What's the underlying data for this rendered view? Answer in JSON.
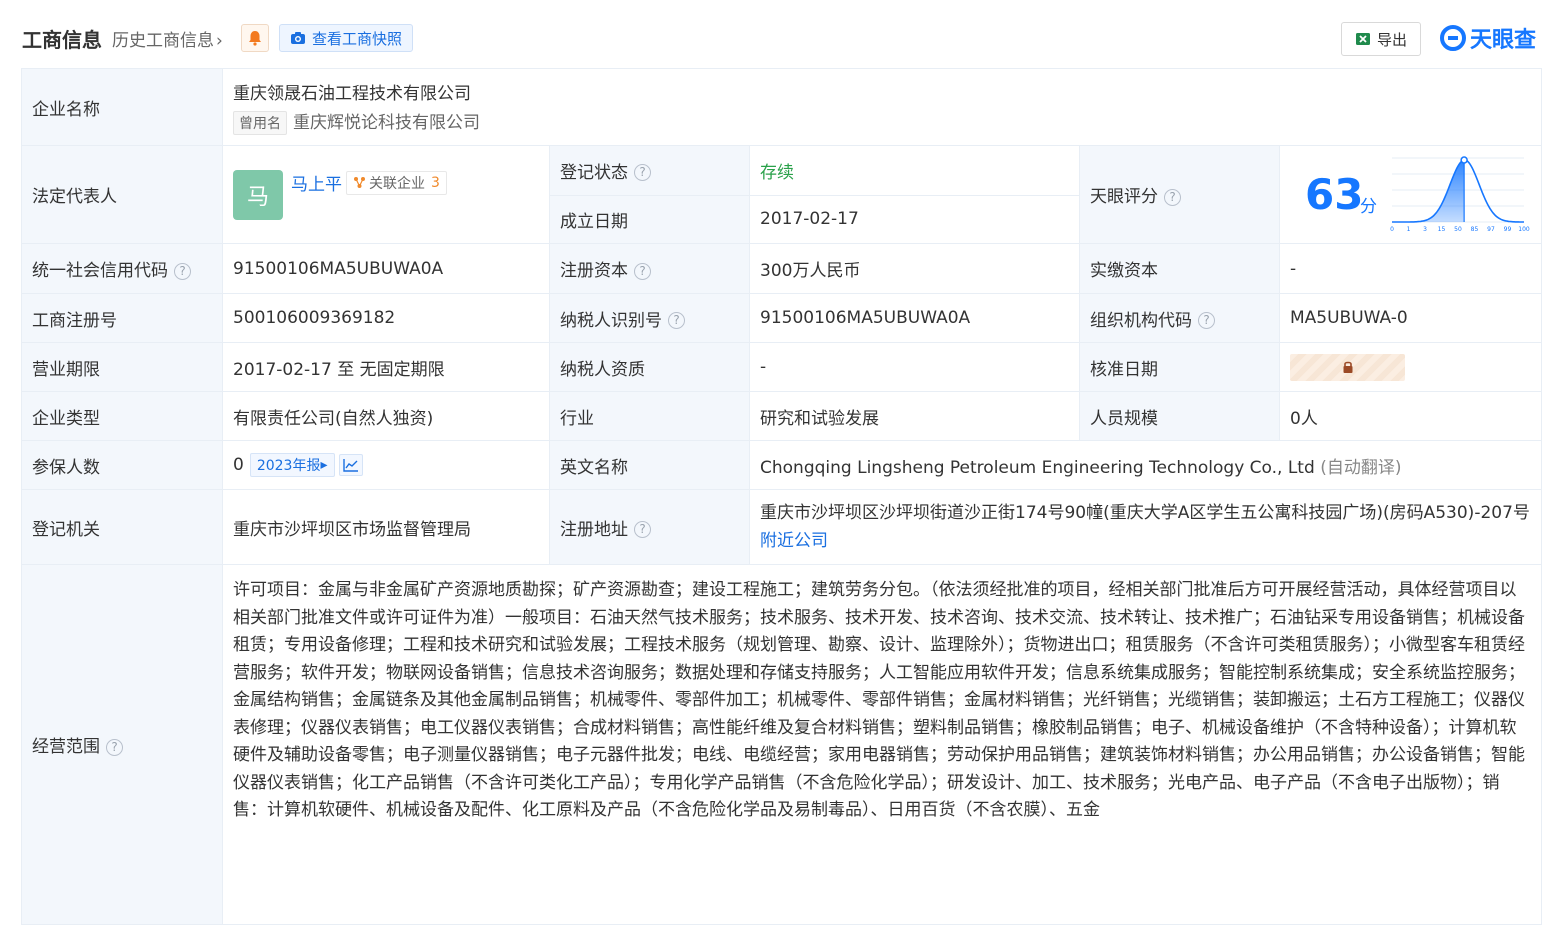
{
  "header": {
    "title": "工商信息",
    "history_link": "历史工商信息",
    "history_chevron": "›",
    "snapshot_button": "查看工商快照",
    "export_button": "导出",
    "logo_text": "天眼查",
    "colors": {
      "accent": "#1677ff",
      "green": "#2aa14a",
      "orange": "#f08a2c"
    }
  },
  "rows": {
    "company_name": {
      "label": "企业名称",
      "value": "重庆领晟石油工程技术有限公司",
      "alt_tag": "曾用名",
      "alt_value": "重庆辉悦论科技有限公司"
    },
    "legal_rep": {
      "label": "法定代表人",
      "avatar_char": "马",
      "name": "马上平",
      "related_label": "关联企业",
      "related_count": "3"
    },
    "reg_status": {
      "label": "登记状态",
      "value": "存续"
    },
    "founded": {
      "label": "成立日期",
      "value": "2017-02-17"
    },
    "tianyan_score": {
      "label": "天眼评分",
      "score": "63",
      "unit": "分",
      "score_level": 63,
      "axis_ticks": [
        "0",
        "1",
        "3",
        "15",
        "50",
        "85",
        "97",
        "99",
        "100"
      ]
    },
    "credit_code": {
      "label": "统一社会信用代码",
      "value": "91500106MA5UBUWA0A"
    },
    "reg_capital": {
      "label": "注册资本",
      "value": "300万人民币"
    },
    "paid_capital": {
      "label": "实缴资本",
      "value": "-"
    },
    "reg_number": {
      "label": "工商注册号",
      "value": "500106009369182"
    },
    "taxpayer_id": {
      "label": "纳税人识别号",
      "value": "91500106MA5UBUWA0A"
    },
    "org_code": {
      "label": "组织机构代码",
      "value": "MA5UBUWA-0"
    },
    "term": {
      "label": "营业期限",
      "value": "2017-02-17 至 无固定期限"
    },
    "tax_qualification": {
      "label": "纳税人资质",
      "value": "-"
    },
    "approval_date": {
      "label": "核准日期"
    },
    "company_type": {
      "label": "企业类型",
      "value": "有限责任公司(自然人独资)"
    },
    "industry": {
      "label": "行业",
      "value": "研究和试验发展"
    },
    "staff_size": {
      "label": "人员规模",
      "value": "0人"
    },
    "insured": {
      "label": "参保人数",
      "value": "0",
      "report_button": "2023年报",
      "report_arrow": "▸"
    },
    "english_name": {
      "label": "英文名称",
      "value": "Chongqing Lingsheng Petroleum Engineering Technology Co., Ltd",
      "auto_translate": "(自动翻译)"
    },
    "reg_authority": {
      "label": "登记机关",
      "value": "重庆市沙坪坝区市场监督管理局"
    },
    "reg_address": {
      "label": "注册地址",
      "value": "重庆市沙坪坝区沙坪坝街道沙正街174号90幢(重庆大学A区学生五公寓科技园广场)(房码A530)-207号",
      "nearby_link": "附近公司"
    },
    "business_scope": {
      "label": "经营范围",
      "value": "许可项目：金属与非金属矿产资源地质勘探；矿产资源勘查；建设工程施工；建筑劳务分包。（依法须经批准的项目，经相关部门批准后方可开展经营活动，具体经营项目以相关部门批准文件或许可证件为准）一般项目：石油天然气技术服务；技术服务、技术开发、技术咨询、技术交流、技术转让、技术推广；石油钻采专用设备销售；机械设备租赁；专用设备修理；工程和技术研究和试验发展；工程技术服务（规划管理、勘察、设计、监理除外）；货物进出口；租赁服务（不含许可类租赁服务）；小微型客车租赁经营服务；软件开发；物联网设备销售；信息技术咨询服务；数据处理和存储支持服务；人工智能应用软件开发；信息系统集成服务；智能控制系统集成；安全系统监控服务；金属结构销售；金属链条及其他金属制品销售；机械零件、零部件加工；机械零件、零部件销售；金属材料销售；光纤销售；光缆销售；装卸搬运；土石方工程施工；仪器仪表修理；仪器仪表销售；电工仪器仪表销售；合成材料销售；高性能纤维及复合材料销售；塑料制品销售；橡胶制品销售；电子、机械设备维护（不含特种设备）；计算机软硬件及辅助设备零售；电子测量仪器销售；电子元器件批发；电线、电缆经营；家用电器销售；劳动保护用品销售；建筑装饰材料销售；办公用品销售；办公设备销售；智能仪器仪表销售；化工产品销售（不含许可类化工产品）；专用化学产品销售（不含危险化学品）；研发设计、加工、技术服务；光电产品、电子产品（不含电子出版物）；销售：计算机软硬件、机械设备及配件、化工原料及产品（不含危险化学品及易制毒品）、日用百货（不含农膜）、五金"
    }
  }
}
